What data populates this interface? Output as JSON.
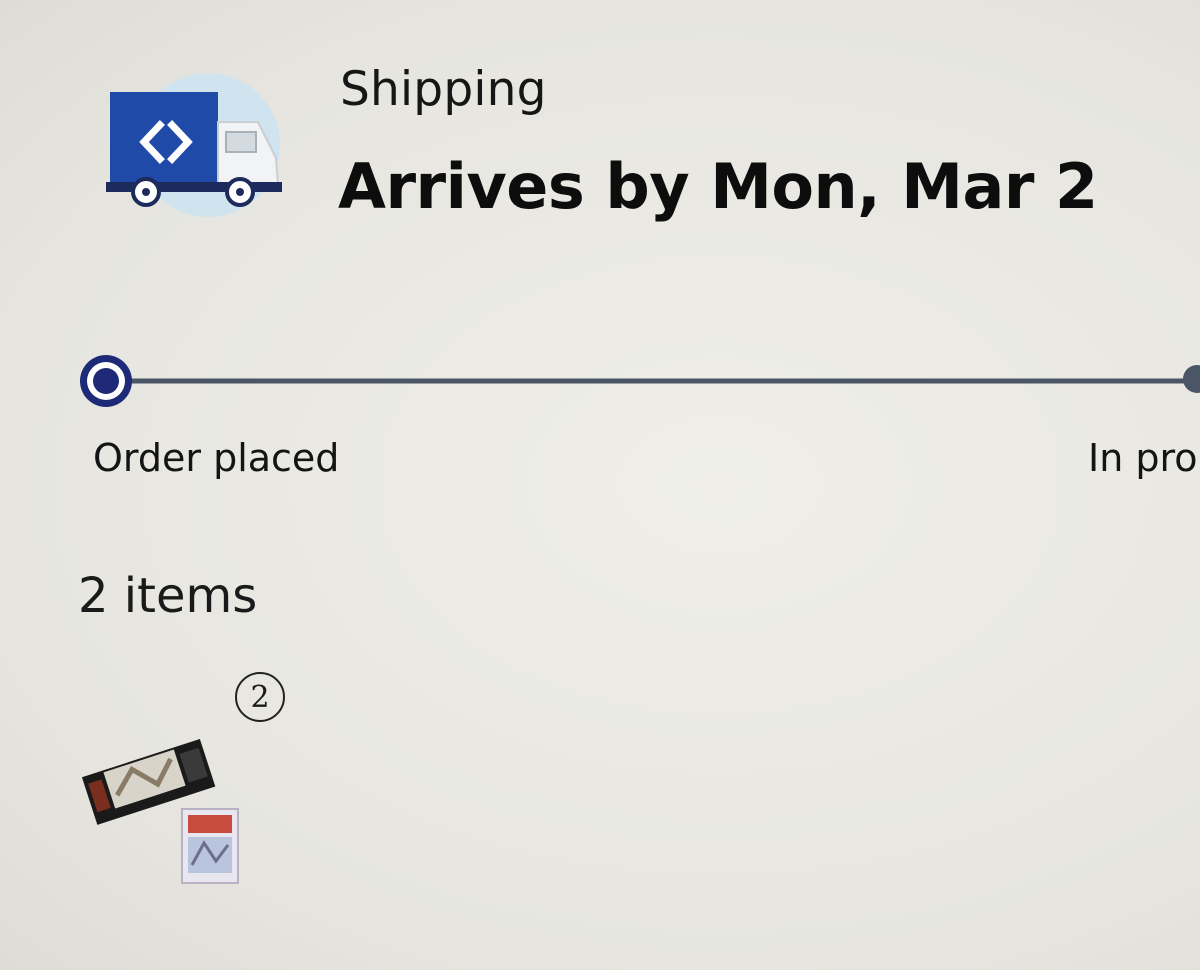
{
  "shipment": {
    "method": "Shipping",
    "arrival": "Arrives by Mon, Mar 2",
    "icon": "delivery-truck-icon"
  },
  "tracker": {
    "steps": [
      {
        "label": "Order placed",
        "status": "current"
      },
      {
        "label": "In pro",
        "status": "upcoming"
      }
    ],
    "colors": {
      "active": "#1e2a78",
      "line": "#4a5566"
    }
  },
  "items": {
    "count_label": "2 items",
    "quantity_badge": "2",
    "thumbnail": "product-image"
  },
  "colors": {
    "brand_blue": "#1f4aa8",
    "icon_circle": "#cfe4ef"
  }
}
